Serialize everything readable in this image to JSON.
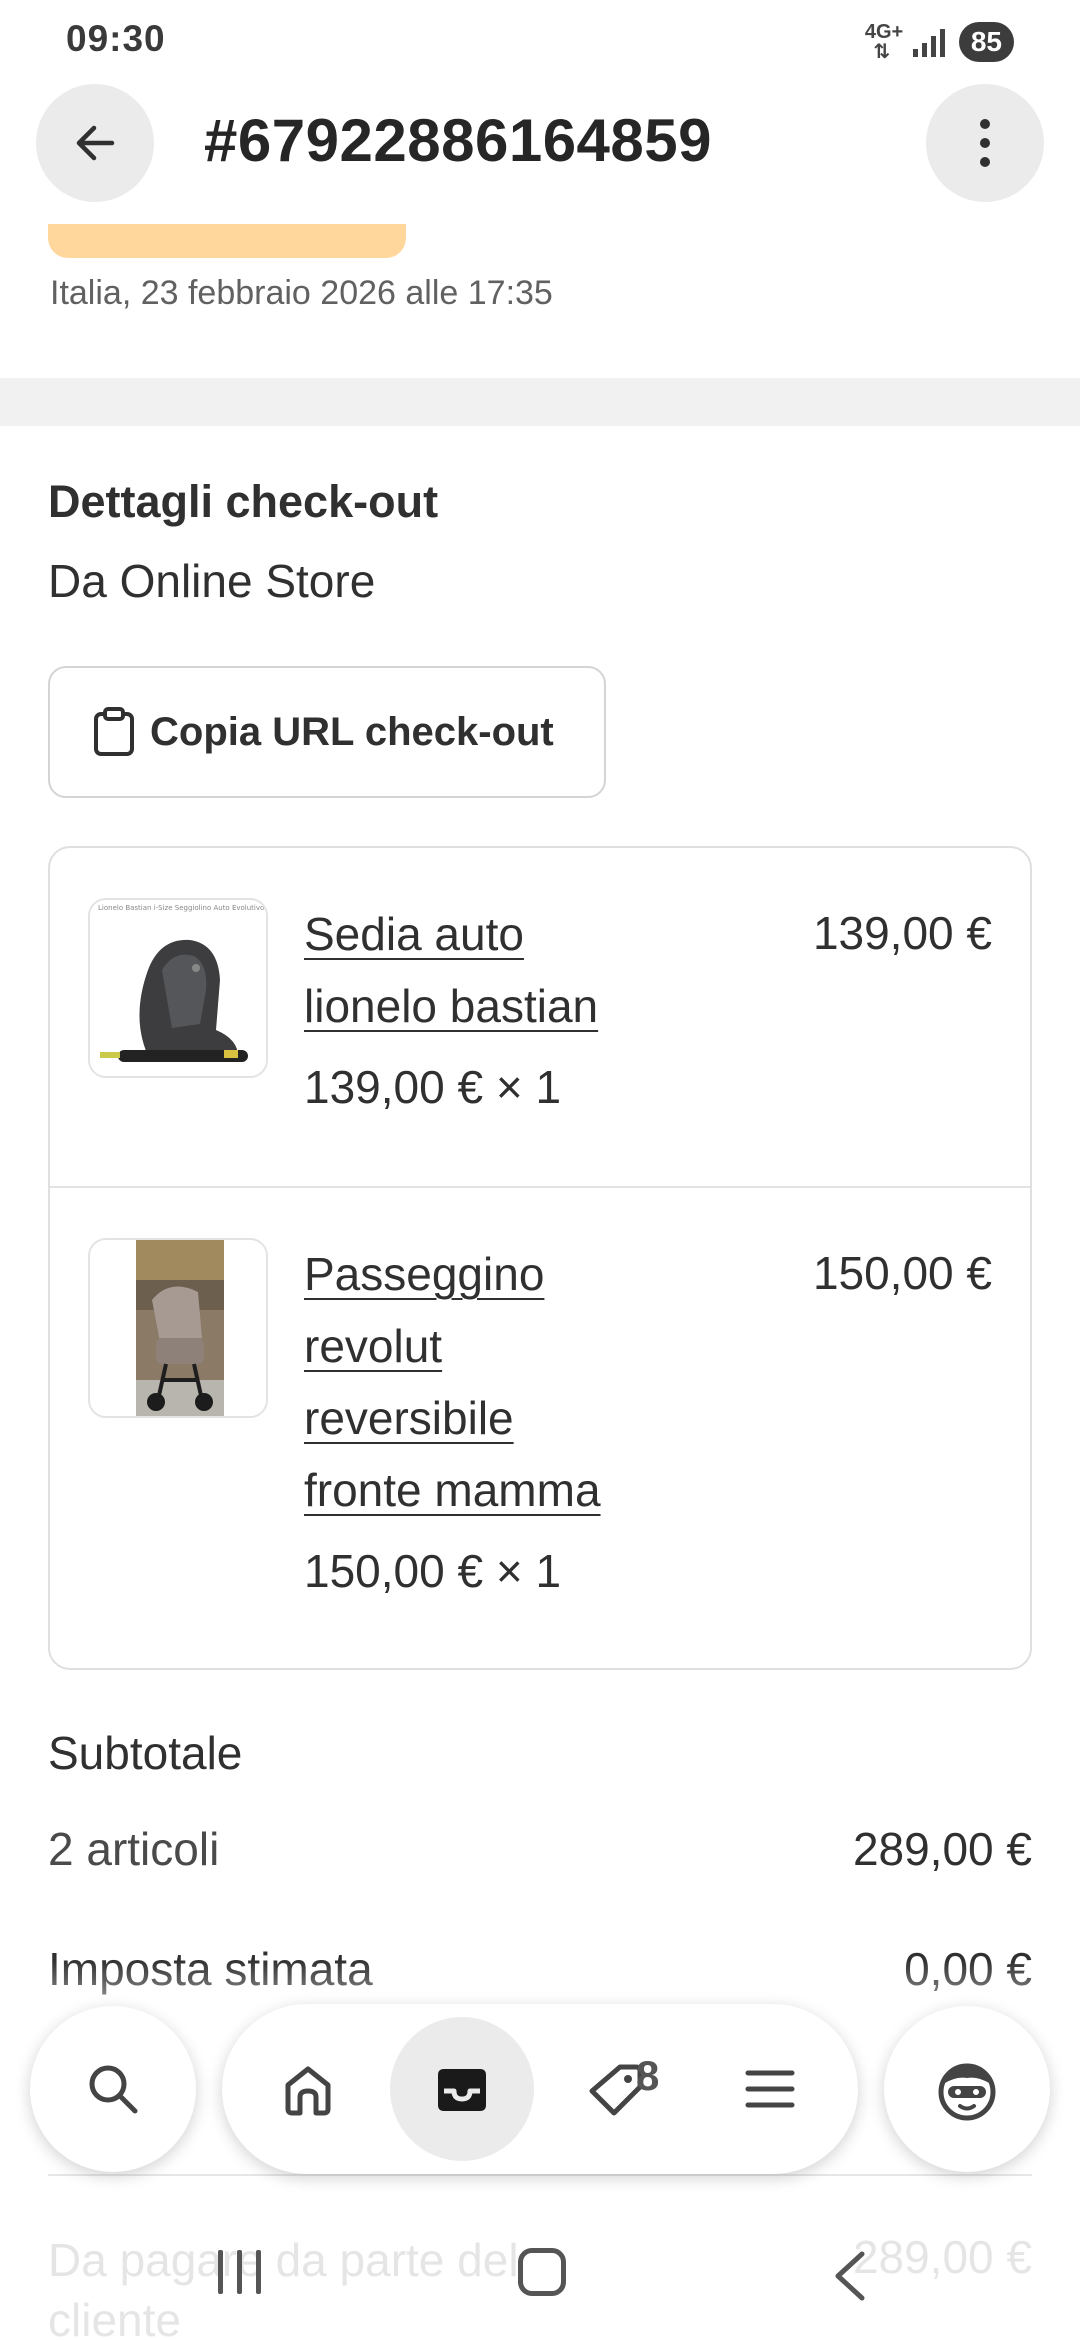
{
  "status_bar": {
    "time": "09:30",
    "network": "4G+",
    "battery": "85"
  },
  "header": {
    "title": "#67922886164859",
    "back_icon": "arrow-left-icon",
    "more_icon": "more-vertical-icon"
  },
  "order": {
    "date": "Italia, 23 febbraio 2026 alle 17:35"
  },
  "checkout": {
    "title": "Dettagli check-out",
    "source": "Da Online Store",
    "copy_button_label": "Copia URL check-out",
    "copy_icon": "clipboard-icon"
  },
  "items": [
    {
      "name_lines": [
        "Sedia auto",
        "lionelo bastian"
      ],
      "qty_text": "139,00 € × 1",
      "price": "139,00 €",
      "image": "car-seat-thumbnail",
      "thumb_caption": "Lionelo Bastian i-Size Seggiolino Auto Evolutivo 40-150 cm ISOFIX 360°"
    },
    {
      "name_lines": [
        "Passeggino",
        "revolut",
        "reversibile",
        "fronte mamma"
      ],
      "qty_text": "150,00 € × 1",
      "price": "150,00 €",
      "image": "stroller-thumbnail"
    }
  ],
  "totals": {
    "subtotal_label": "Subtotale",
    "items_count_label": "2 articoli",
    "items_count_value": "289,00 €",
    "tax_label": "Imposta stimata",
    "tax_value": "0,00 €",
    "due_label_line1": "Da pagare da parte del",
    "due_label_line2": "cliente",
    "due_value": "289,00 €"
  },
  "tabbar": {
    "tabs": [
      {
        "name": "home-icon"
      },
      {
        "name": "inbox-icon",
        "active": true
      },
      {
        "name": "tag-icon"
      },
      {
        "name": "menu-icon"
      }
    ],
    "badge": "8",
    "search_icon": "search-icon",
    "profile_icon": "avatar-icon"
  },
  "colors": {
    "badge_orange": "#ffd79d",
    "separator": "#f1f1f1",
    "text": "#303030"
  }
}
